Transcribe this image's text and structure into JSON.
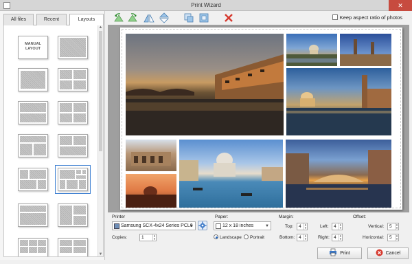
{
  "window": {
    "title": "Print Wizard",
    "close_glyph": "✕"
  },
  "left_tabs": [
    {
      "label": "All files",
      "active": false
    },
    {
      "label": "Recent",
      "active": false
    },
    {
      "label": "Layouts",
      "active": true
    }
  ],
  "layouts": {
    "manual_label": "MANUAL\nLAYOUT",
    "selected_index": 9
  },
  "toolbar": {
    "icons": [
      "rotate-left-icon",
      "rotate-right-icon",
      "flip-horizontal-icon",
      "flip-vertical-icon",
      "fit-icon",
      "fill-icon",
      "delete-icon"
    ],
    "keep_aspect_label": "Keep aspect ratio of photos",
    "keep_aspect_checked": false
  },
  "printer": {
    "section_label": "Printer",
    "selected": "Samsung SCX-4x24 Series PCL6",
    "copies_label": "Copies:",
    "copies_value": "1"
  },
  "paper": {
    "section_label": "Paper:",
    "selected": "12 x 18 inches",
    "orientations": [
      {
        "label": "Landscape",
        "checked": true
      },
      {
        "label": "Portrait",
        "checked": false
      }
    ]
  },
  "margin": {
    "section_label": "Margin:",
    "top_label": "Top:",
    "top_value": "4",
    "bottom_label": "Bottom:",
    "bottom_value": "4",
    "left_label": "Left:",
    "left_value": "4",
    "right_label": "Right:",
    "right_value": "4"
  },
  "offset": {
    "section_label": "Offset:",
    "vertical_label": "Vertical:",
    "vertical_value": "5",
    "horizontal_label": "Horizontal:",
    "horizontal_value": "5"
  },
  "buttons": {
    "print_label": "Print",
    "cancel_label": "Cancel"
  },
  "colors": {
    "accent": "#3d7fd1",
    "cancel_red": "#d63a2f",
    "close_red": "#c74b3f"
  }
}
